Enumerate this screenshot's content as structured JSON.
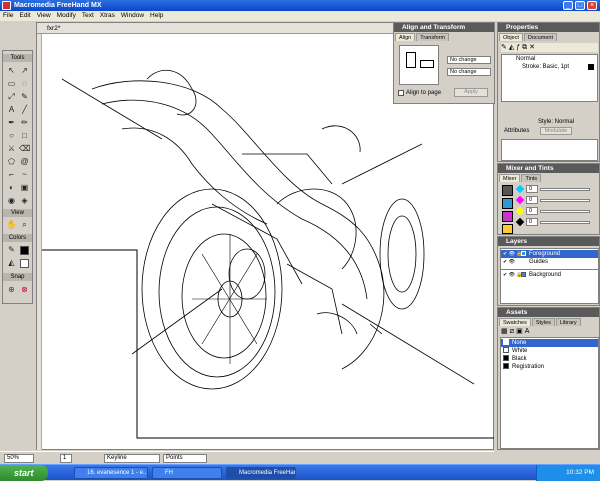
{
  "window": {
    "title": "Macromedia FreeHand MX",
    "minimize": "_",
    "maximize": "□",
    "close": "×"
  },
  "menu": [
    "File",
    "Edit",
    "View",
    "Modify",
    "Text",
    "Xtras",
    "Window",
    "Help"
  ],
  "toolbox": {
    "sections": [
      "Tools",
      "View",
      "Colors",
      "Snap"
    ]
  },
  "document": {
    "tab": "fxr2*"
  },
  "status": {
    "zoom": "50%",
    "page": "1",
    "mode": "Keyline",
    "units": "Points"
  },
  "align_panel": {
    "title": "Align and Transform",
    "tabs": [
      "Align",
      "Transform"
    ],
    "horizontal": "No change",
    "vertical": "No change",
    "align_to_page": "Align to page",
    "apply": "Apply"
  },
  "properties_panel": {
    "title": "Properties",
    "tabs": [
      "Object",
      "Document"
    ],
    "items": [
      "Normal",
      "Stroke: Basic, 1pt"
    ],
    "style_label": "Style: Normal",
    "attributes_label": "Attributes",
    "attributes_button": "Modulate"
  },
  "mixer_panel": {
    "title": "Mixer and Tints",
    "tabs": [
      "Mixer",
      "Tints"
    ],
    "channels": [
      "0",
      "0",
      "0",
      "0"
    ]
  },
  "layers_panel": {
    "title": "Layers",
    "layers": [
      "Foreground",
      "Guides",
      "Background"
    ]
  },
  "assets_panel": {
    "title": "Assets",
    "tabs": [
      "Swatches",
      "Styles",
      "Library"
    ],
    "swatches": [
      {
        "name": "None",
        "color": "#ffffff"
      },
      {
        "name": "White",
        "color": "#ffffff"
      },
      {
        "name": "Black",
        "color": "#000000"
      },
      {
        "name": "Registration",
        "color": "#000000"
      }
    ]
  },
  "taskbar": {
    "start": "start",
    "tasks": [
      "16. evanesence 1 - e...",
      "FH",
      "Macromedia FreeHan..."
    ],
    "clock": "10:32 PM"
  },
  "colors": {
    "accent": "#0a46c8",
    "highlight": "#3366cc",
    "layer_blue": "#3b8ed6"
  }
}
